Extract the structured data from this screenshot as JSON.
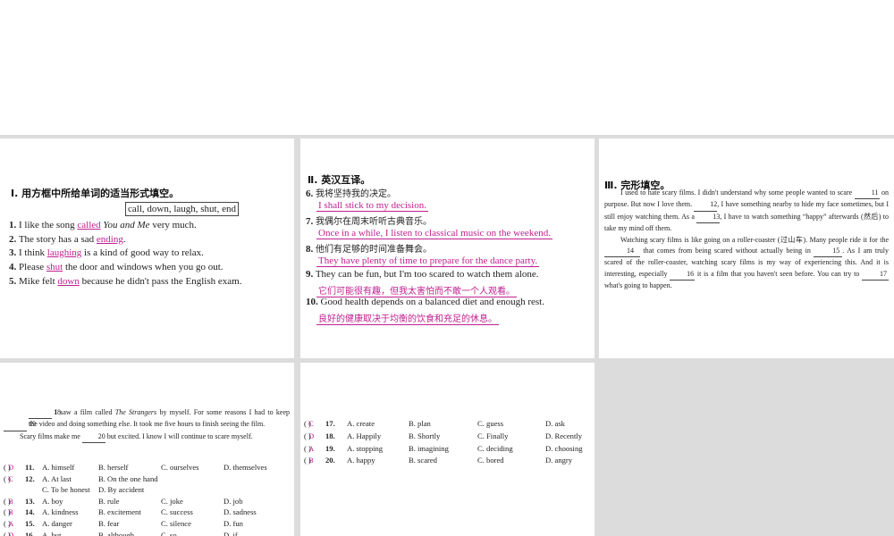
{
  "section1": {
    "title": "Ⅰ. 用方框中所给单词的适当形式填空。",
    "word_box": "call, down, laugh, shut, end",
    "items": [
      {
        "num": "1.",
        "pre": "I like the song ",
        "ans": "called",
        "post": " ",
        "post_italic": "You and Me",
        "post2": " very much."
      },
      {
        "num": "2.",
        "pre": "The story has a sad ",
        "ans": "ending",
        "post": ".",
        "post_italic": "",
        "post2": ""
      },
      {
        "num": "3.",
        "pre": "I think ",
        "ans": "laughing",
        "post": " is a kind of good way to relax.",
        "post_italic": "",
        "post2": ""
      },
      {
        "num": "4.",
        "pre": "Please ",
        "ans": "shut",
        "post": " the door and windows when you go out.",
        "post_italic": "",
        "post2": ""
      },
      {
        "num": "5.",
        "pre": "Mike felt ",
        "ans": "down",
        "post": " because he didn't pass the English exam.",
        "post_italic": "",
        "post2": ""
      }
    ]
  },
  "section2": {
    "title": "Ⅱ. 英汉互译。",
    "items": [
      {
        "num": "6.",
        "q": "我将坚持我的决定。",
        "a": "I shall stick to my decision."
      },
      {
        "num": "7.",
        "q": "我偶尔在周末听听古典音乐。",
        "a": "Once in a while, I listen to classical music on the weekend."
      },
      {
        "num": "8.",
        "q": "他们有足够的时间准备舞会。",
        "a": "They have plenty of time to prepare for the dance party."
      },
      {
        "num": "9.",
        "q": "They can be fun, but I'm too scared to watch them alone.",
        "a": "它们可能很有趣，但我太害怕而不敢一个人观看。"
      },
      {
        "num": "10.",
        "q": "Good health depends on a balanced diet and enough rest.",
        "a": "良好的健康取决于均衡的饮食和充足的休息。"
      }
    ]
  },
  "section3": {
    "title": "Ⅲ. 完形填空。",
    "p1_a": "I used to hate scary films. I didn't understand why some people wanted to scare ",
    "b11": "11",
    "p1_b": " on purpose. But now I love them. ",
    "b12": "12",
    "p1_c": ", I have something nearby to hide my face sometimes, but I still enjoy watching them. As a ",
    "b13": "13",
    "p1_d": ", I have to watch something “happy” afterwards (然后) to take my mind off them.",
    "p2_a": "Watching scary films is like going on a roller-coaster (过山车). Many people ride it for the ",
    "b14": "14",
    "p2_b": " that comes from being scared without actually being in ",
    "b15": "15",
    "p2_c": ". As I am truly scared of the roller-coaster, watching scary films is my way of experiencing this. And it is interesting, especially ",
    "b16": "16",
    "p2_d": " it is a film that you haven't seen before. You can try to ",
    "b17": "17",
    "p2_e": " what's going to happen."
  },
  "section4": {
    "p1_blank": "18",
    "p1_a": " I saw a film called ",
    "p1_italic": "The Strangers",
    "p1_b": " by myself. For some reasons I had to keep ",
    "p1_blank2": "19",
    "p1_c": " the video and doing something else. It took me five hours to finish seeing the film.",
    "p2_a": "Scary films make me ",
    "p2_blank": "20",
    "p2_b": " but excited. I know I will continue to scare myself.",
    "questions": [
      {
        "ans": "D",
        "num": "11.",
        "A": "A. himself",
        "B": "B. herself",
        "C": "C. ourselves",
        "D": "D. themselves"
      },
      {
        "ans": "C",
        "num": "12.",
        "A": "A. At last",
        "B": "B. On the one hand",
        "C": "C. To be honest",
        "D": "D. By accident"
      },
      {
        "ans": "B",
        "num": "13.",
        "A": "A. boy",
        "B": "B. rule",
        "C": "C. joke",
        "D": "D. job"
      },
      {
        "ans": "B",
        "num": "14.",
        "A": "A. kindness",
        "B": "B. excitement",
        "C": "C. success",
        "D": "D. sadness"
      },
      {
        "ans": "A",
        "num": "15.",
        "A": "A. danger",
        "B": "B. fear",
        "C": "C. silence",
        "D": "D. fun"
      },
      {
        "ans": "D",
        "num": "16.",
        "A": "A. but",
        "B": "B. although",
        "C": "C. so",
        "D": "D. if"
      }
    ]
  },
  "section5": {
    "questions": [
      {
        "ans": "C",
        "num": "17.",
        "A": "A. create",
        "B": "B. plan",
        "C": "C. guess",
        "D": "D. ask"
      },
      {
        "ans": "D",
        "num": "18.",
        "A": "A. Happily",
        "B": "B. Shortly",
        "C": "C. Finally",
        "D": "D. Recently"
      },
      {
        "ans": "A",
        "num": "19.",
        "A": "A. stopping",
        "B": "B. imagining",
        "C": "C. deciding",
        "D": "D. choosing"
      },
      {
        "ans": "B",
        "num": "20.",
        "A": "A. happy",
        "B": "B. scared",
        "C": "C. bored",
        "D": "D. angry"
      }
    ]
  },
  "colors": {
    "answer": "#c0208f",
    "background": "#dcdcdc",
    "panel": "#ffffff"
  }
}
